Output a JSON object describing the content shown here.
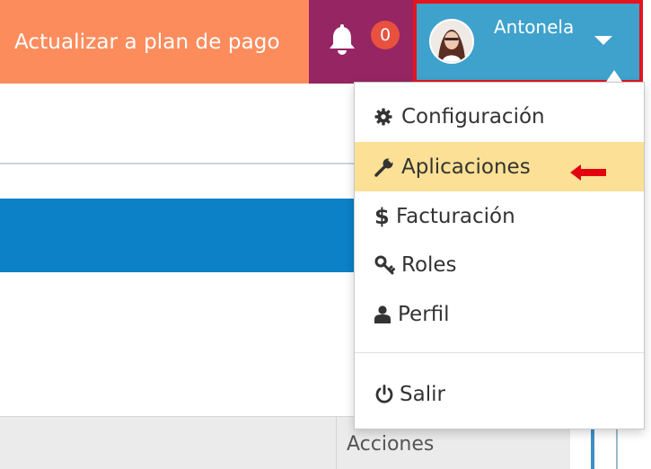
{
  "header": {
    "upgrade_label": "Actualizar a plan de pago",
    "notifications_count": "0",
    "user_name": "Antonela"
  },
  "menu": {
    "items": [
      {
        "label": "Configuración",
        "icon": "gear-icon"
      },
      {
        "label": "Aplicaciones",
        "icon": "wrench-icon",
        "highlighted": true
      },
      {
        "label": "Facturación",
        "icon": "dollar-icon"
      },
      {
        "label": "Roles",
        "icon": "key-icon"
      },
      {
        "label": "Perfil",
        "icon": "user-icon"
      }
    ],
    "logout_label": "Salir"
  },
  "table": {
    "actions_header": "Acciones"
  },
  "colors": {
    "upgrade_bg": "#fd8c5c",
    "notif_bg": "#962563",
    "badge_bg": "#e8513f",
    "user_bg": "#3ea2cc",
    "highlight_outline": "#e5141d",
    "active_item_bg": "#fbe095",
    "blue_bar": "#0c81c8"
  }
}
